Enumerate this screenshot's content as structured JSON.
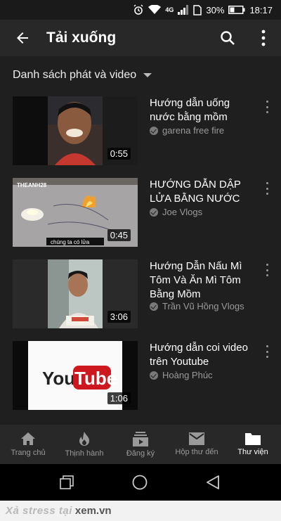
{
  "status": {
    "battery": "30%",
    "time": "18:17",
    "network": "4G"
  },
  "appbar": {
    "title": "Tải xuống"
  },
  "filter": {
    "label": "Danh sách phát và video"
  },
  "videos": [
    {
      "title": "Hướng dẫn uống nước bằng mồm",
      "channel": "garena free fire",
      "duration": "0:55"
    },
    {
      "title": "HƯỚNG DẪN DẬP LỬA BẰNG NƯỚC",
      "channel": "Joe Vlogs",
      "duration": "0:45",
      "thumb_logo": "THEANH28",
      "thumb_caption": "chúng ta có lửa"
    },
    {
      "title": "Hướng Dẫn Nấu Mì Tôm Và Ăn Mì Tôm Bằng Mồm",
      "channel": "Trần Vũ Hồng Vlogs",
      "duration": "3:06"
    },
    {
      "title": "Hướng dẫn coi video trên Youtube",
      "channel": "Hoàng Phúc",
      "duration": "1:06",
      "thumb_logo_you": "You",
      "thumb_logo_tube": "Tube"
    }
  ],
  "bottom_nav": [
    {
      "label": "Trang chủ",
      "icon": "home-icon"
    },
    {
      "label": "Thịnh hành",
      "icon": "flame-icon"
    },
    {
      "label": "Đăng ký",
      "icon": "subscriptions-icon"
    },
    {
      "label": "Hộp thư đến",
      "icon": "mail-icon"
    },
    {
      "label": "Thư viện",
      "icon": "folder-icon",
      "active": true
    }
  ],
  "footer": {
    "part1": "Xả stress tại",
    "part2": "xem.vn"
  },
  "colors": {
    "background": "#1f1f1f",
    "appbar": "#282828",
    "youtube_red": "#cc181e"
  }
}
